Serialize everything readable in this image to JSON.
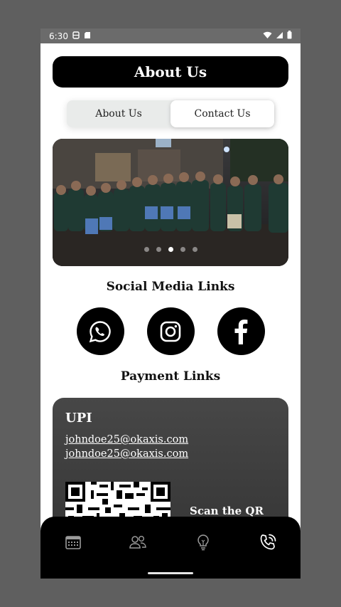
{
  "status_bar": {
    "time": "6:30",
    "icons": [
      "sim-icon",
      "storage-icon",
      "wifi-icon",
      "signal-icon",
      "battery-icon"
    ]
  },
  "header": {
    "title": "About Us"
  },
  "tabs": [
    {
      "label": "About Us",
      "active": false
    },
    {
      "label": "Contact Us",
      "active": true
    }
  ],
  "carousel": {
    "slide_count": 5,
    "active_index": 2
  },
  "social": {
    "title": "Social Media Links",
    "links": [
      {
        "name": "whatsapp",
        "icon": "whatsapp-icon"
      },
      {
        "name": "instagram",
        "icon": "instagram-icon"
      },
      {
        "name": "facebook",
        "icon": "facebook-icon"
      }
    ]
  },
  "payment": {
    "title": "Payment Links",
    "upi": {
      "title": "UPI",
      "ids": [
        "johndoe25@okaxis.com",
        "johndoe25@okaxis.com"
      ],
      "scan_text": "Scan the QR"
    }
  },
  "bottom_nav": {
    "items": [
      {
        "icon": "calendar-icon",
        "active": false
      },
      {
        "icon": "people-icon",
        "active": false
      },
      {
        "icon": "lightbulb-icon",
        "active": false
      },
      {
        "icon": "phone-call-icon",
        "active": true
      }
    ]
  },
  "colors": {
    "primary": "#000000",
    "tab_bg": "#e9ebea",
    "card_bg": "#3a3a3a",
    "status_bar": "#6b6b6b",
    "backdrop": "#5f5f5f"
  }
}
